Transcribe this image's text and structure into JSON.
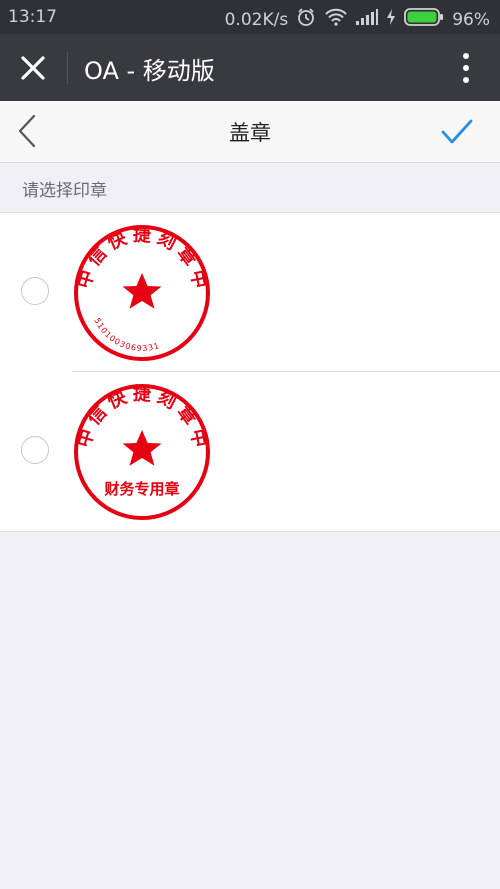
{
  "status": {
    "time": "13:17",
    "network_speed": "0.02K/s",
    "battery": "96%"
  },
  "appbar": {
    "title": "OA - 移动版"
  },
  "subbar": {
    "title": "盖章"
  },
  "section": {
    "label": "请选择印章"
  },
  "seals": [
    {
      "org": "中信快捷刻章中心",
      "number": "5101003069331"
    },
    {
      "org": "中信快捷刻章中心",
      "bottom": "财务专用章"
    }
  ],
  "colors": {
    "seal_red": "#e60012",
    "accent": "#2a8de0"
  }
}
